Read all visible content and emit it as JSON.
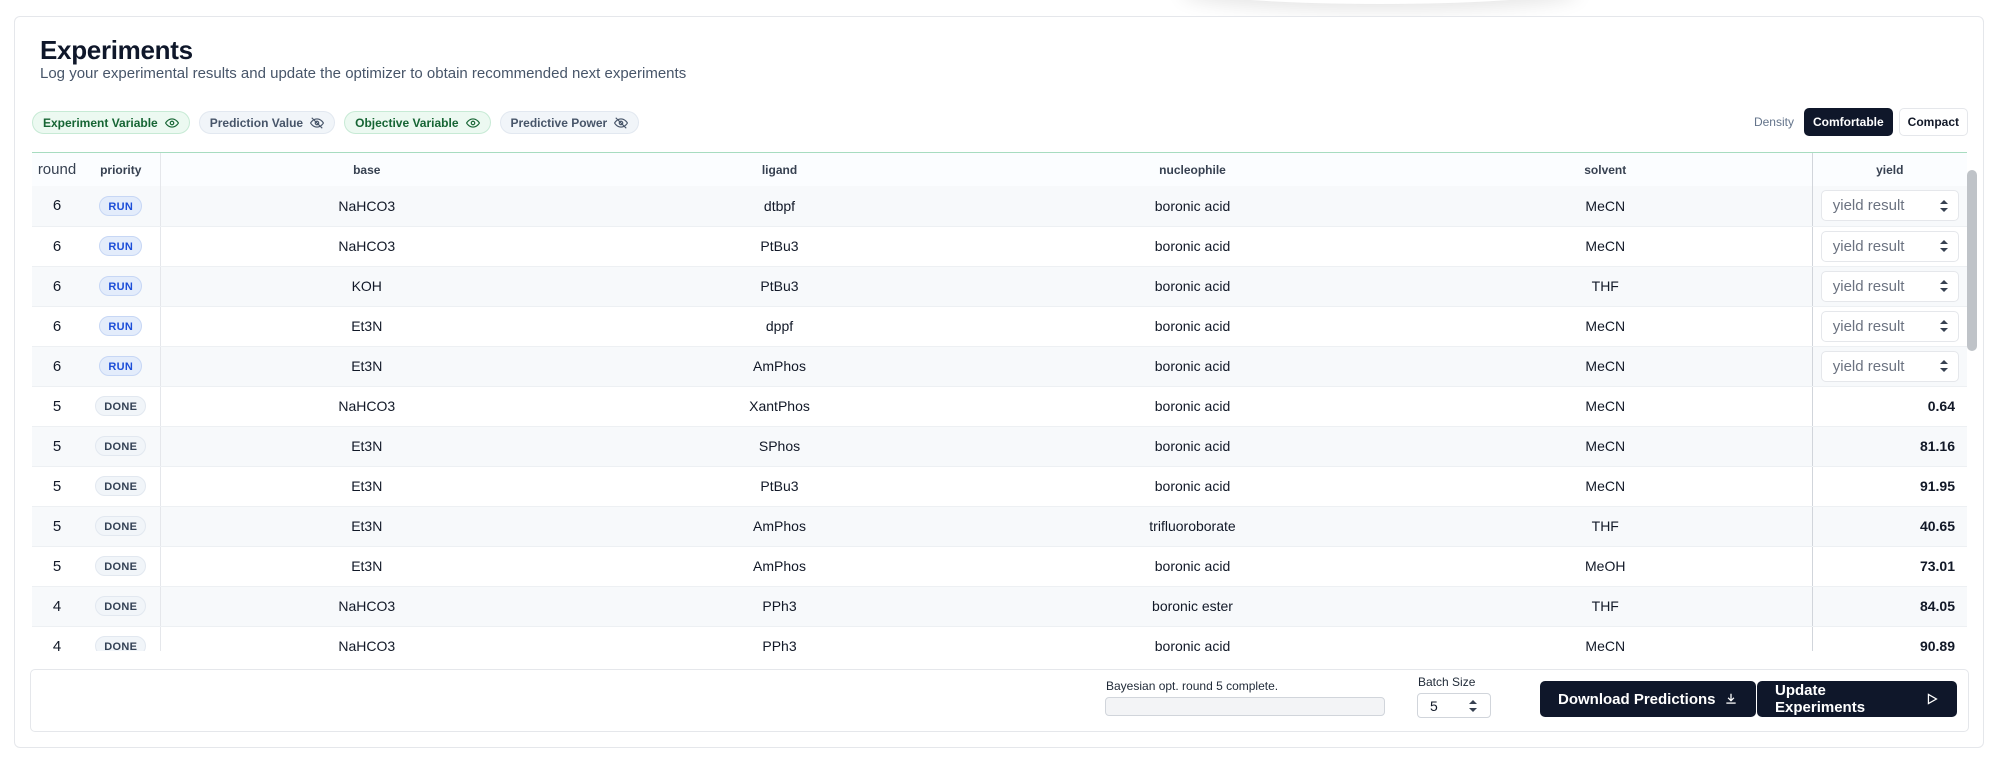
{
  "header": {
    "title": "Experiments",
    "subtitle": "Log your experimental results and update the optimizer to obtain recommended next experiments"
  },
  "legend": [
    {
      "label": "Experiment Variable",
      "style": "green",
      "icon": "eye-icon"
    },
    {
      "label": "Prediction Value",
      "style": "gray",
      "icon": "eye-off-icon"
    },
    {
      "label": "Objective Variable",
      "style": "green",
      "icon": "eye-icon"
    },
    {
      "label": "Predictive Power",
      "style": "gray",
      "icon": "eye-off-icon"
    }
  ],
  "density": {
    "label": "Density",
    "options": [
      "Comfortable",
      "Compact"
    ],
    "selected": "Comfortable"
  },
  "table": {
    "columns": [
      "round",
      "priority",
      "base",
      "ligand",
      "nucleophile",
      "solvent",
      "yield"
    ],
    "yield_placeholder": "yield result",
    "rows": [
      {
        "round": "6",
        "priority": "RUN",
        "base": "NaHCO3",
        "ligand": "dtbpf",
        "nucleophile": "boronic acid",
        "solvent": "MeCN",
        "yield": null
      },
      {
        "round": "6",
        "priority": "RUN",
        "base": "NaHCO3",
        "ligand": "PtBu3",
        "nucleophile": "boronic acid",
        "solvent": "MeCN",
        "yield": null
      },
      {
        "round": "6",
        "priority": "RUN",
        "base": "KOH",
        "ligand": "PtBu3",
        "nucleophile": "boronic acid",
        "solvent": "THF",
        "yield": null
      },
      {
        "round": "6",
        "priority": "RUN",
        "base": "Et3N",
        "ligand": "dppf",
        "nucleophile": "boronic acid",
        "solvent": "MeCN",
        "yield": null
      },
      {
        "round": "6",
        "priority": "RUN",
        "base": "Et3N",
        "ligand": "AmPhos",
        "nucleophile": "boronic acid",
        "solvent": "MeCN",
        "yield": null
      },
      {
        "round": "5",
        "priority": "DONE",
        "base": "NaHCO3",
        "ligand": "XantPhos",
        "nucleophile": "boronic acid",
        "solvent": "MeCN",
        "yield": "0.64"
      },
      {
        "round": "5",
        "priority": "DONE",
        "base": "Et3N",
        "ligand": "SPhos",
        "nucleophile": "boronic acid",
        "solvent": "MeCN",
        "yield": "81.16"
      },
      {
        "round": "5",
        "priority": "DONE",
        "base": "Et3N",
        "ligand": "PtBu3",
        "nucleophile": "boronic acid",
        "solvent": "MeCN",
        "yield": "91.95"
      },
      {
        "round": "5",
        "priority": "DONE",
        "base": "Et3N",
        "ligand": "AmPhos",
        "nucleophile": "trifluoroborate",
        "solvent": "THF",
        "yield": "40.65"
      },
      {
        "round": "5",
        "priority": "DONE",
        "base": "Et3N",
        "ligand": "AmPhos",
        "nucleophile": "boronic acid",
        "solvent": "MeOH",
        "yield": "73.01"
      },
      {
        "round": "4",
        "priority": "DONE",
        "base": "NaHCO3",
        "ligand": "PPh3",
        "nucleophile": "boronic ester",
        "solvent": "THF",
        "yield": "84.05"
      },
      {
        "round": "4",
        "priority": "DONE",
        "base": "NaHCO3",
        "ligand": "PPh3",
        "nucleophile": "boronic acid",
        "solvent": "MeCN",
        "yield": "90.89"
      }
    ]
  },
  "footer": {
    "status": "Bayesian opt. round 5 complete.",
    "progress": 0,
    "batch_label": "Batch Size",
    "batch_value": "5",
    "download_label": "Download Predictions",
    "update_label": "Update Experiments"
  },
  "colors": {
    "primary": "#0f172a",
    "green_chip_bg": "#ecf9f1",
    "green_chip_text": "#166534",
    "run_badge_bg": "#e3ecfb",
    "run_badge_text": "#1d4ed8"
  }
}
